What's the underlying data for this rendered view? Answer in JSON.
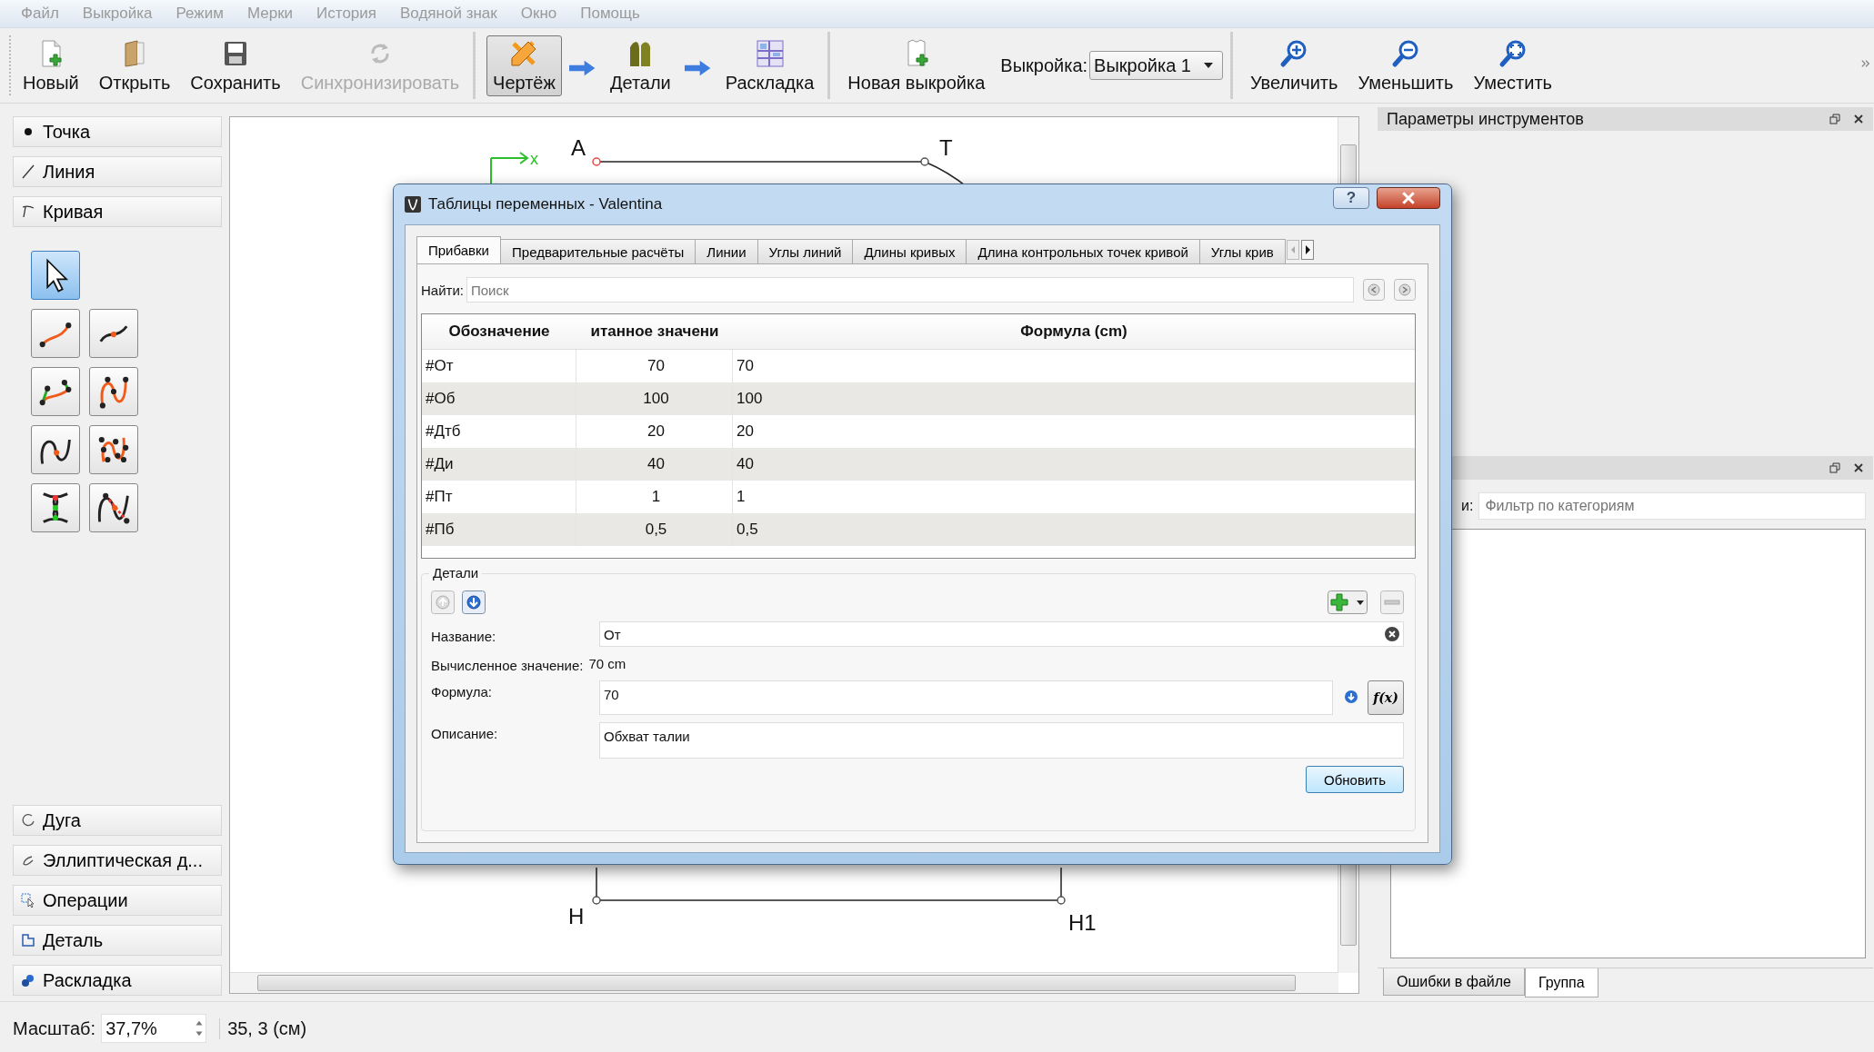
{
  "menu": [
    "Файл",
    "Выкройка",
    "Режим",
    "Мерки",
    "История",
    "Водяной знак",
    "Окно",
    "Помощь"
  ],
  "toolbar": {
    "file_buttons": [
      {
        "kind": "new",
        "label": "Новый",
        "disabled": false
      },
      {
        "kind": "open",
        "label": "Открыть",
        "disabled": false
      },
      {
        "kind": "save",
        "label": "Сохранить",
        "disabled": false
      },
      {
        "kind": "sync",
        "label": "Синхронизировать",
        "disabled": true
      }
    ],
    "modes": [
      {
        "kind": "draft",
        "label": "Чертёж",
        "selected": true
      },
      {
        "kind": "details",
        "label": "Детали",
        "selected": false
      },
      {
        "kind": "layout",
        "label": "Раскладка",
        "selected": false
      }
    ],
    "new_pattern": "Новая выкройка",
    "pattern_label": "Выкройка:",
    "pattern_value": "Выкройка 1",
    "zoom_buttons": [
      {
        "kind": "zoom-in",
        "label": "Увеличить"
      },
      {
        "kind": "zoom-out",
        "label": "Уменьшить"
      },
      {
        "kind": "fit",
        "label": "Уместить"
      }
    ]
  },
  "tool_sections_top": [
    {
      "kind": "point",
      "label": "Точка"
    },
    {
      "kind": "line",
      "label": "Линия"
    },
    {
      "kind": "curve",
      "label": "Кривая"
    }
  ],
  "tools": [
    {
      "kind": "pointer",
      "selected": true
    },
    {
      "kind": "spline",
      "selected": false
    },
    {
      "kind": "spline-point",
      "selected": false
    },
    {
      "kind": "spline-path",
      "selected": false
    },
    {
      "kind": "cubic-path",
      "selected": false
    },
    {
      "kind": "cut-spline",
      "selected": false
    },
    {
      "kind": "control-path",
      "selected": false
    },
    {
      "kind": "intersection",
      "selected": false
    },
    {
      "kind": "cut-path",
      "selected": false
    }
  ],
  "tool_sections_bottom": [
    {
      "kind": "arc",
      "label": "Дуга"
    },
    {
      "kind": "elliptical-arc",
      "label": "Эллиптическая д..."
    },
    {
      "kind": "operations",
      "label": "Операции"
    },
    {
      "kind": "detail",
      "label": "Деталь"
    },
    {
      "kind": "layout",
      "label": "Раскладка"
    }
  ],
  "canvas": {
    "axis_label": "x",
    "points": [
      "A",
      "T",
      "H",
      "H1"
    ]
  },
  "tool_options": {
    "title": "Параметры инструментов"
  },
  "groups_panel": {
    "label": "и:",
    "filter_placeholder": "Фильтр по категориям"
  },
  "dock_tabs": [
    {
      "label": "Ошибки в файле",
      "selected": false
    },
    {
      "label": "Группа",
      "selected": true
    }
  ],
  "status_bar": {
    "scale_label": "Масштаб:",
    "scale_value": "37,7%",
    "coordinates": "35, 3 (см)"
  },
  "dialog": {
    "title": "Таблицы переменных - Valentina",
    "help": "?",
    "tabs": [
      {
        "label": "Прибавки",
        "selected": true
      },
      {
        "label": "Предварительные расчёты",
        "selected": false
      },
      {
        "label": "Линии",
        "selected": false
      },
      {
        "label": "Углы линий",
        "selected": false
      },
      {
        "label": "Длины кривых",
        "selected": false
      },
      {
        "label": "Длина контрольных точек кривой",
        "selected": false
      },
      {
        "label": "Углы крив",
        "selected": false
      }
    ],
    "search_label": "Найти:",
    "search_placeholder": "Поиск",
    "columns": [
      "Обозначение",
      "итанное значени",
      "Формула (cm)"
    ],
    "rows": [
      {
        "name": "#От",
        "value": "70",
        "formula": "70"
      },
      {
        "name": "#Об",
        "value": "100",
        "formula": "100"
      },
      {
        "name": "#Дтб",
        "value": "20",
        "formula": "20"
      },
      {
        "name": "#Ди",
        "value": "40",
        "formula": "40"
      },
      {
        "name": "#Пт",
        "value": "1",
        "formula": "1"
      },
      {
        "name": "#Пб",
        "value": "0,5",
        "formula": "0,5"
      }
    ],
    "details": {
      "title": "Детали",
      "name_label": "Название:",
      "name_value": "От",
      "computed_label": "Вычисленное значение:",
      "computed_value": "70 cm",
      "formula_label": "Формула:",
      "formula_value": "70",
      "function_button": "f(x)",
      "description_label": "Описание:",
      "description_value": "Обхват талии",
      "update_button": "Обновить"
    }
  }
}
